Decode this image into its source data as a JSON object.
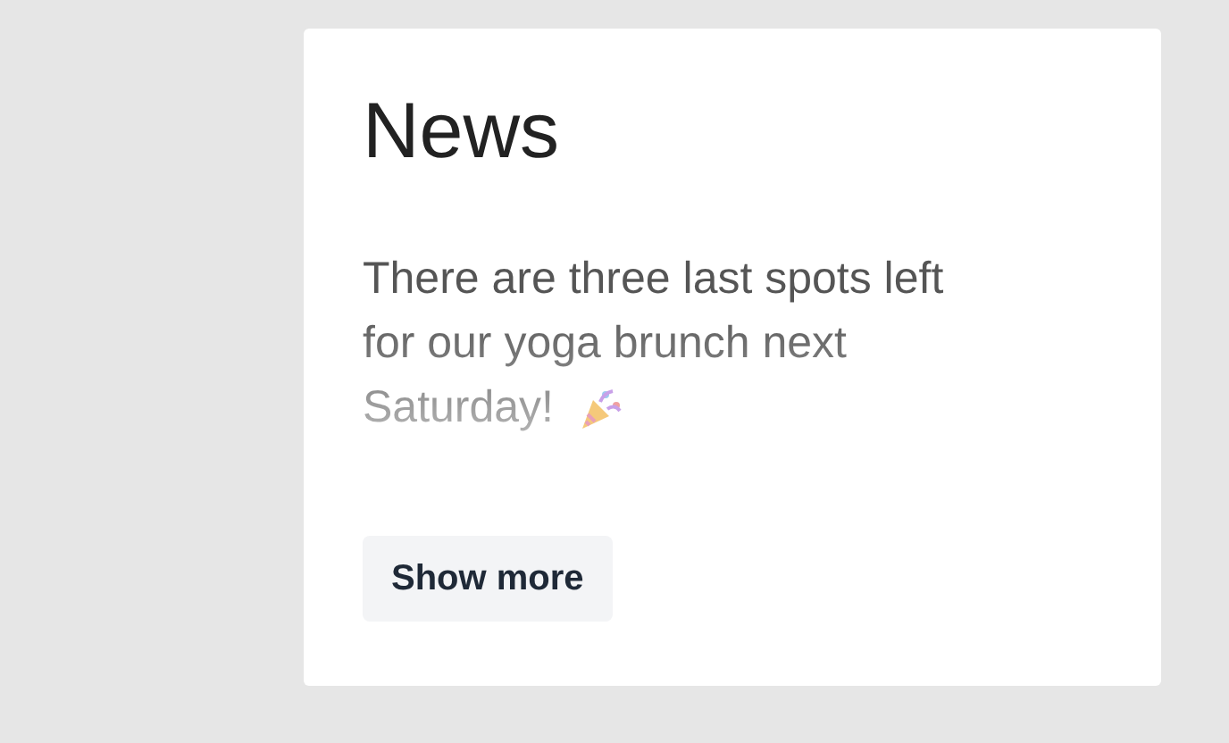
{
  "card": {
    "title": "News",
    "text": "There are three last spots left for our yoga brunch next Saturday!",
    "button": "Show more"
  }
}
